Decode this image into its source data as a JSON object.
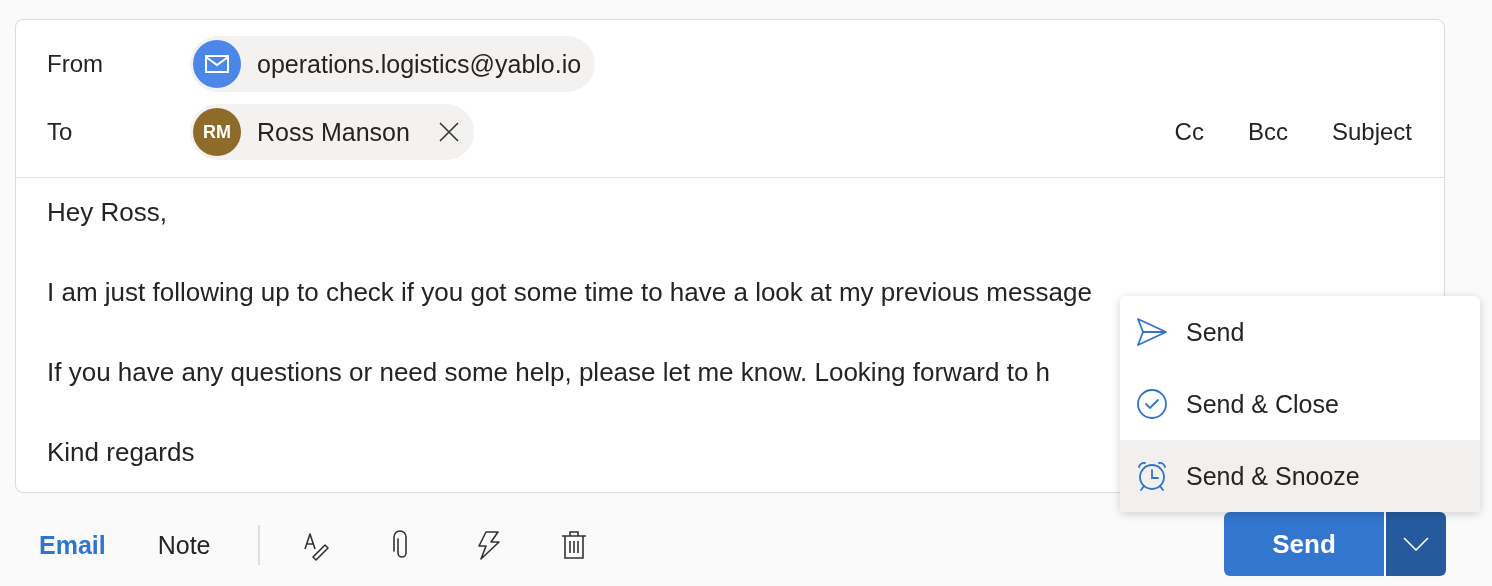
{
  "from": {
    "label": "From",
    "address": "operations.logistics@yablo.io"
  },
  "to": {
    "label": "To",
    "recipients": [
      {
        "initials": "RM",
        "name": "Ross Manson",
        "color": "#8f6b2a"
      }
    ]
  },
  "header_links": [
    "Cc",
    "Bcc",
    "Subject"
  ],
  "body": [
    "Hey Ross,",
    "I am just following up to check if you got some time to have a look at my previous message",
    "If you have any questions or need some help, please let me know. Looking forward to h",
    "Kind regards"
  ],
  "tabs": [
    {
      "label": "Email",
      "selected": true
    },
    {
      "label": "Note",
      "selected": false
    }
  ],
  "tools": [
    {
      "kind": "format"
    },
    {
      "kind": "attach"
    },
    {
      "kind": "quick"
    },
    {
      "kind": "delete"
    }
  ],
  "send_button": {
    "label": "Send"
  },
  "send_menu": [
    {
      "kind": "send",
      "label": "Send",
      "selected": false
    },
    {
      "kind": "close",
      "label": "Send & Close",
      "selected": false
    },
    {
      "kind": "snooze",
      "label": "Send & Snooze",
      "selected": true
    }
  ]
}
